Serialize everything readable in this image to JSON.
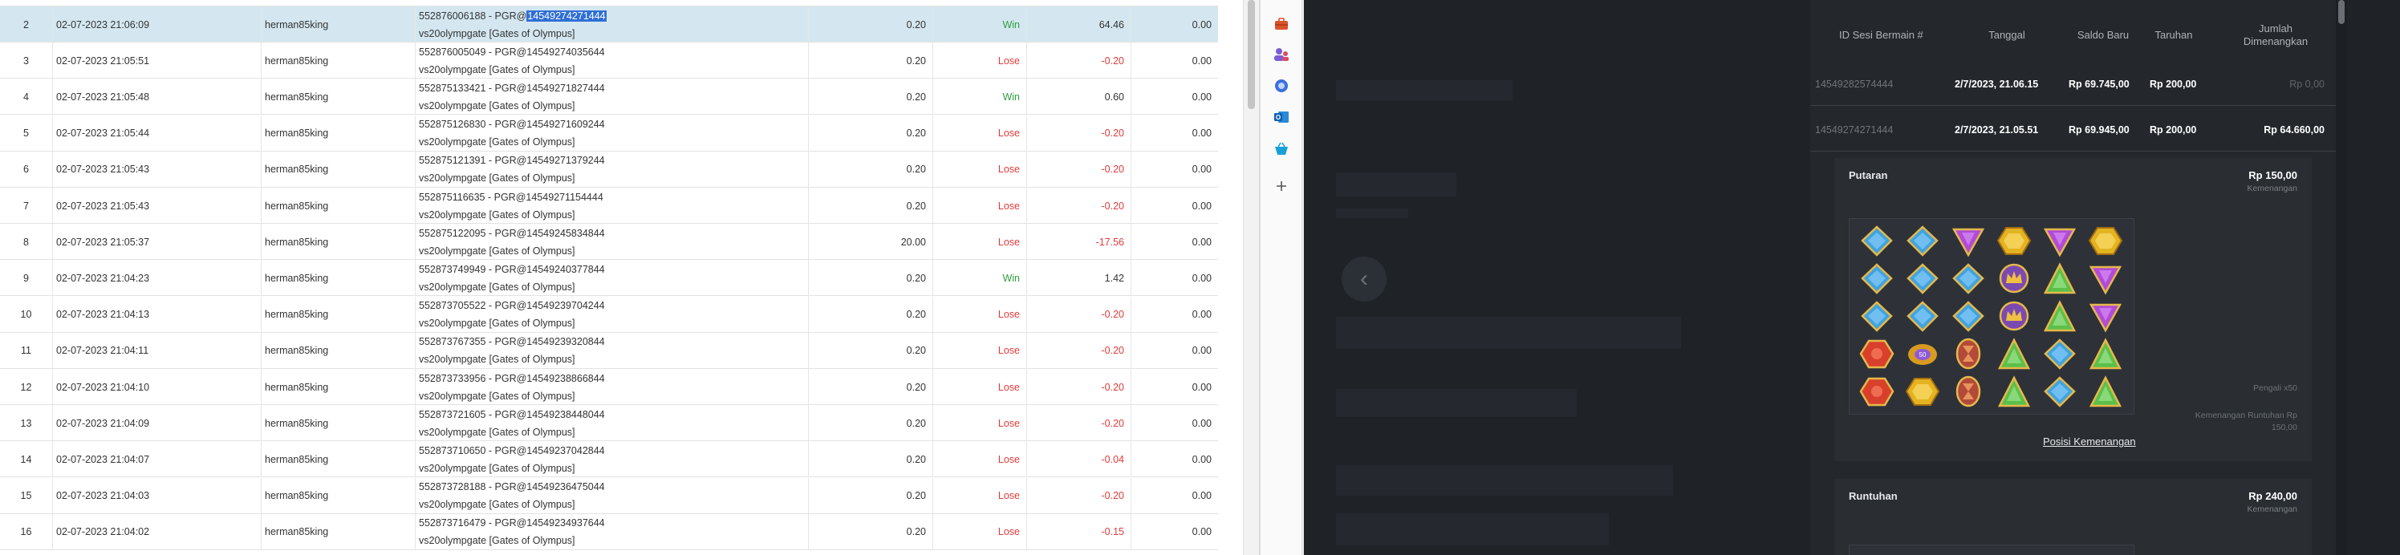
{
  "table": {
    "rows": [
      {
        "no": "2",
        "date": "02-07-2023 21:06:09",
        "user": "herman85king",
        "desc_prefix": "552876006188 - PGR@",
        "desc_hl": "14549274271444",
        "desc_line2": "vs20olympgate [Gates of Olympus]",
        "bet": "0.20",
        "result": "Win",
        "winloss": "64.46",
        "jp": "0.00",
        "selected": true
      },
      {
        "no": "3",
        "date": "02-07-2023 21:05:51",
        "user": "herman85king",
        "desc_prefix": "552876005049 - PGR@14549274035644",
        "desc_hl": "",
        "desc_line2": "vs20olympgate [Gates of Olympus]",
        "bet": "0.20",
        "result": "Lose",
        "winloss": "-0.20",
        "jp": "0.00"
      },
      {
        "no": "4",
        "date": "02-07-2023 21:05:48",
        "user": "herman85king",
        "desc_prefix": "552875133421 - PGR@14549271827444",
        "desc_hl": "",
        "desc_line2": "vs20olympgate [Gates of Olympus]",
        "bet": "0.20",
        "result": "Win",
        "winloss": "0.60",
        "jp": "0.00"
      },
      {
        "no": "5",
        "date": "02-07-2023 21:05:44",
        "user": "herman85king",
        "desc_prefix": "552875126830 - PGR@14549271609244",
        "desc_hl": "",
        "desc_line2": "vs20olympgate [Gates of Olympus]",
        "bet": "0.20",
        "result": "Lose",
        "winloss": "-0.20",
        "jp": "0.00"
      },
      {
        "no": "6",
        "date": "02-07-2023 21:05:43",
        "user": "herman85king",
        "desc_prefix": "552875121391 - PGR@14549271379244",
        "desc_hl": "",
        "desc_line2": "vs20olympgate [Gates of Olympus]",
        "bet": "0.20",
        "result": "Lose",
        "winloss": "-0.20",
        "jp": "0.00"
      },
      {
        "no": "7",
        "date": "02-07-2023 21:05:43",
        "user": "herman85king",
        "desc_prefix": "552875116635 - PGR@14549271154444",
        "desc_hl": "",
        "desc_line2": "vs20olympgate [Gates of Olympus]",
        "bet": "0.20",
        "result": "Lose",
        "winloss": "-0.20",
        "jp": "0.00"
      },
      {
        "no": "8",
        "date": "02-07-2023 21:05:37",
        "user": "herman85king",
        "desc_prefix": "552875122095 - PGR@14549245834844",
        "desc_hl": "",
        "desc_line2": "vs20olympgate [Gates of Olympus]",
        "bet": "20.00",
        "result": "Lose",
        "winloss": "-17.56",
        "jp": "0.00"
      },
      {
        "no": "9",
        "date": "02-07-2023 21:04:23",
        "user": "herman85king",
        "desc_prefix": "552873749949 - PGR@14549240377844",
        "desc_hl": "",
        "desc_line2": "vs20olympgate [Gates of Olympus]",
        "bet": "0.20",
        "result": "Win",
        "winloss": "1.42",
        "jp": "0.00"
      },
      {
        "no": "10",
        "date": "02-07-2023 21:04:13",
        "user": "herman85king",
        "desc_prefix": "552873705522 - PGR@14549239704244",
        "desc_hl": "",
        "desc_line2": "vs20olympgate [Gates of Olympus]",
        "bet": "0.20",
        "result": "Lose",
        "winloss": "-0.20",
        "jp": "0.00"
      },
      {
        "no": "11",
        "date": "02-07-2023 21:04:11",
        "user": "herman85king",
        "desc_prefix": "552873767355 - PGR@14549239320844",
        "desc_hl": "",
        "desc_line2": "vs20olympgate [Gates of Olympus]",
        "bet": "0.20",
        "result": "Lose",
        "winloss": "-0.20",
        "jp": "0.00"
      },
      {
        "no": "12",
        "date": "02-07-2023 21:04:10",
        "user": "herman85king",
        "desc_prefix": "552873733956 - PGR@14549238866844",
        "desc_hl": "",
        "desc_line2": "vs20olympgate [Gates of Olympus]",
        "bet": "0.20",
        "result": "Lose",
        "winloss": "-0.20",
        "jp": "0.00"
      },
      {
        "no": "13",
        "date": "02-07-2023 21:04:09",
        "user": "herman85king",
        "desc_prefix": "552873721605 - PGR@14549238448044",
        "desc_hl": "",
        "desc_line2": "vs20olympgate [Gates of Olympus]",
        "bet": "0.20",
        "result": "Lose",
        "winloss": "-0.20",
        "jp": "0.00"
      },
      {
        "no": "14",
        "date": "02-07-2023 21:04:07",
        "user": "herman85king",
        "desc_prefix": "552873710650 - PGR@14549237042844",
        "desc_hl": "",
        "desc_line2": "vs20olympgate [Gates of Olympus]",
        "bet": "0.20",
        "result": "Lose",
        "winloss": "-0.04",
        "jp": "0.00"
      },
      {
        "no": "15",
        "date": "02-07-2023 21:04:03",
        "user": "herman85king",
        "desc_prefix": "552873728188 - PGR@14549236475044",
        "desc_hl": "",
        "desc_line2": "vs20olympgate [Gates of Olympus]",
        "bet": "0.20",
        "result": "Lose",
        "winloss": "-0.20",
        "jp": "0.00"
      },
      {
        "no": "16",
        "date": "02-07-2023 21:04:02",
        "user": "herman85king",
        "desc_prefix": "552873716479 - PGR@14549234937644",
        "desc_hl": "",
        "desc_line2": "vs20olympgate [Gates of Olympus]",
        "bet": "0.20",
        "result": "Lose",
        "winloss": "-0.15",
        "jp": "0.00"
      }
    ]
  },
  "rail": {
    "icons": [
      "toolbox-icon",
      "people-icon",
      "gem-icon",
      "outlook-icon",
      "basket-icon",
      "plus-icon"
    ]
  },
  "modal": {
    "headers": {
      "id": "ID Sesi Bermain #",
      "date": "Tanggal",
      "balance": "Saldo Baru",
      "bet": "Taruhan",
      "win": "Jumlah Dimenangkan"
    },
    "rows": [
      {
        "id": "14549282574444",
        "date": "2/7/2023, 21.06.15",
        "balance": "Rp 69.745,00",
        "bet": "Rp 200,00",
        "win": "Rp 0,00",
        "win_active": false
      },
      {
        "id": "14549274271444",
        "date": "2/7/2023, 21.05.51",
        "balance": "Rp 69.945,00",
        "bet": "Rp 200,00",
        "win": "Rp 64.660,00",
        "win_active": true
      }
    ],
    "spin_card": {
      "title": "Putaran",
      "amount": "Rp 150,00",
      "amount_sub": "Kemenangan",
      "multiplier_label": "Pengali x50",
      "cascade_win_label": "Kemenangan Runtuhan Rp 150,00",
      "link": "Posisi Kemenangan"
    },
    "cascade_card": {
      "title": "Runtuhan",
      "amount": "Rp 240,00",
      "amount_sub": "Kemenangan"
    },
    "grid": [
      [
        "blue",
        "blue",
        "purple",
        "gold",
        "purple",
        "gold"
      ],
      [
        "blue",
        "blue",
        "blue",
        "crown",
        "green",
        "purple"
      ],
      [
        "blue",
        "blue",
        "blue",
        "crown",
        "green",
        "purple"
      ],
      [
        "red",
        "ring",
        "hourglass",
        "green",
        "blue",
        "green"
      ],
      [
        "red",
        "gold",
        "hourglass",
        "green",
        "blue",
        "green"
      ]
    ],
    "colors": {
      "blue": "#3fa3e0",
      "purple": "#b14bd8",
      "gold": "#e4b320",
      "green": "#5bc04a",
      "red": "#d8402c",
      "crown": "#7b4ab0",
      "ring": "#d89a20",
      "hourglass": "#b24a3a"
    }
  }
}
